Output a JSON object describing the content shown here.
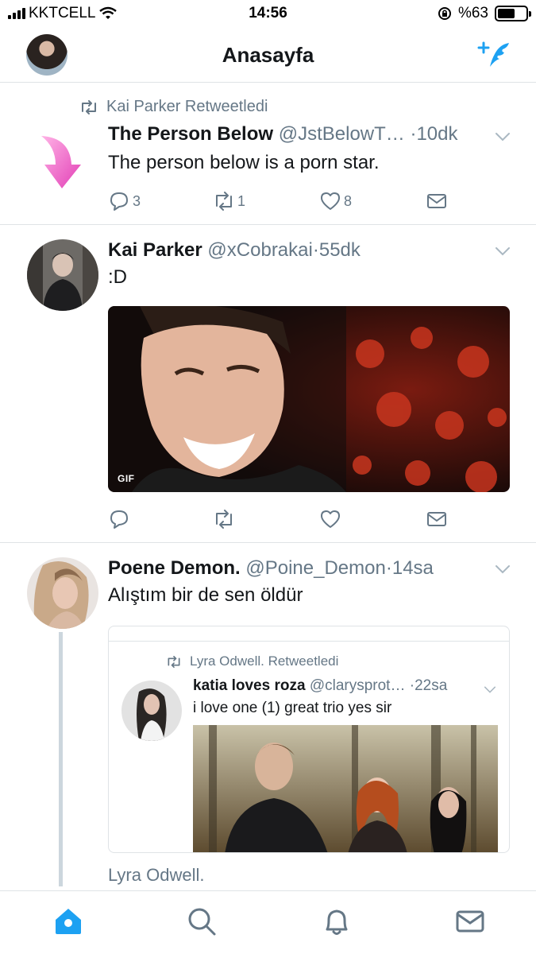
{
  "status_bar": {
    "carrier": "KKTCELL",
    "time": "14:56",
    "battery": "%63",
    "battery_level": 0.63
  },
  "header": {
    "title": "Anasayfa"
  },
  "tweets": [
    {
      "retweeted_by": "Kai Parker Retweetledi",
      "name": "The Person Below",
      "handle": "@JstBelowT…",
      "dot": "·",
      "time": "10dk",
      "text": "The person below is a porn star.",
      "replies": "3",
      "retweets": "1",
      "likes": "8"
    },
    {
      "name": "Kai Parker",
      "handle": "@xCobrakai",
      "dot": "·",
      "time": "55dk",
      "text": ":D",
      "media_badge": "GIF"
    },
    {
      "name": "Poene Demon.",
      "handle": "@Poine_Demon",
      "dot": "·",
      "time": "14sa",
      "text": "Alıştım bir de sen öldür",
      "quote": {
        "retweeted_by": "Lyra Odwell. Retweetledi",
        "name": "katia loves roza",
        "handle": "@clarysprot…",
        "dot": "·",
        "time": "22sa",
        "text": "i love one (1) great trio yes sir"
      },
      "footer_text": "Lyra Odwell."
    }
  ],
  "tab_bar": {
    "items": [
      "home-icon",
      "search-icon",
      "notifications-icon",
      "messages-icon"
    ]
  },
  "colors": {
    "accent": "#1da1f2",
    "secondary_text": "#657786",
    "divider": "#dfe3e6"
  }
}
